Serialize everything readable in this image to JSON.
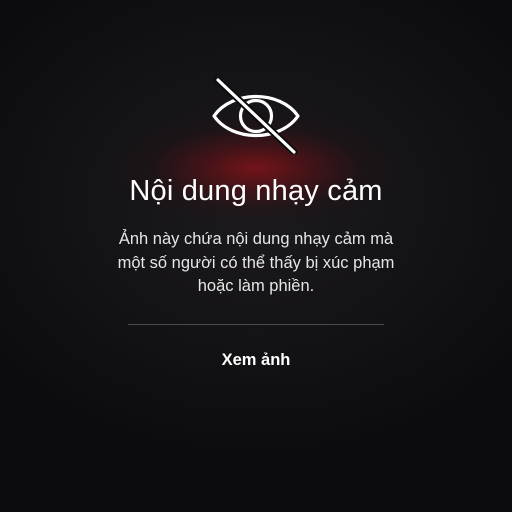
{
  "overlay": {
    "icon": "eye-slash-icon",
    "title": "Nội dung nhạy cảm",
    "description_lines": [
      "Ảnh này chứa nội dung nhạy cảm mà",
      "một số người có thể thấy bị xúc phạm",
      "hoặc làm phiền."
    ],
    "view_button_label": "Xem ảnh"
  },
  "colors": {
    "background": "#0c0c0e",
    "glow": "#96121a",
    "text": "#ffffff",
    "divider": "#4a4a4c"
  }
}
